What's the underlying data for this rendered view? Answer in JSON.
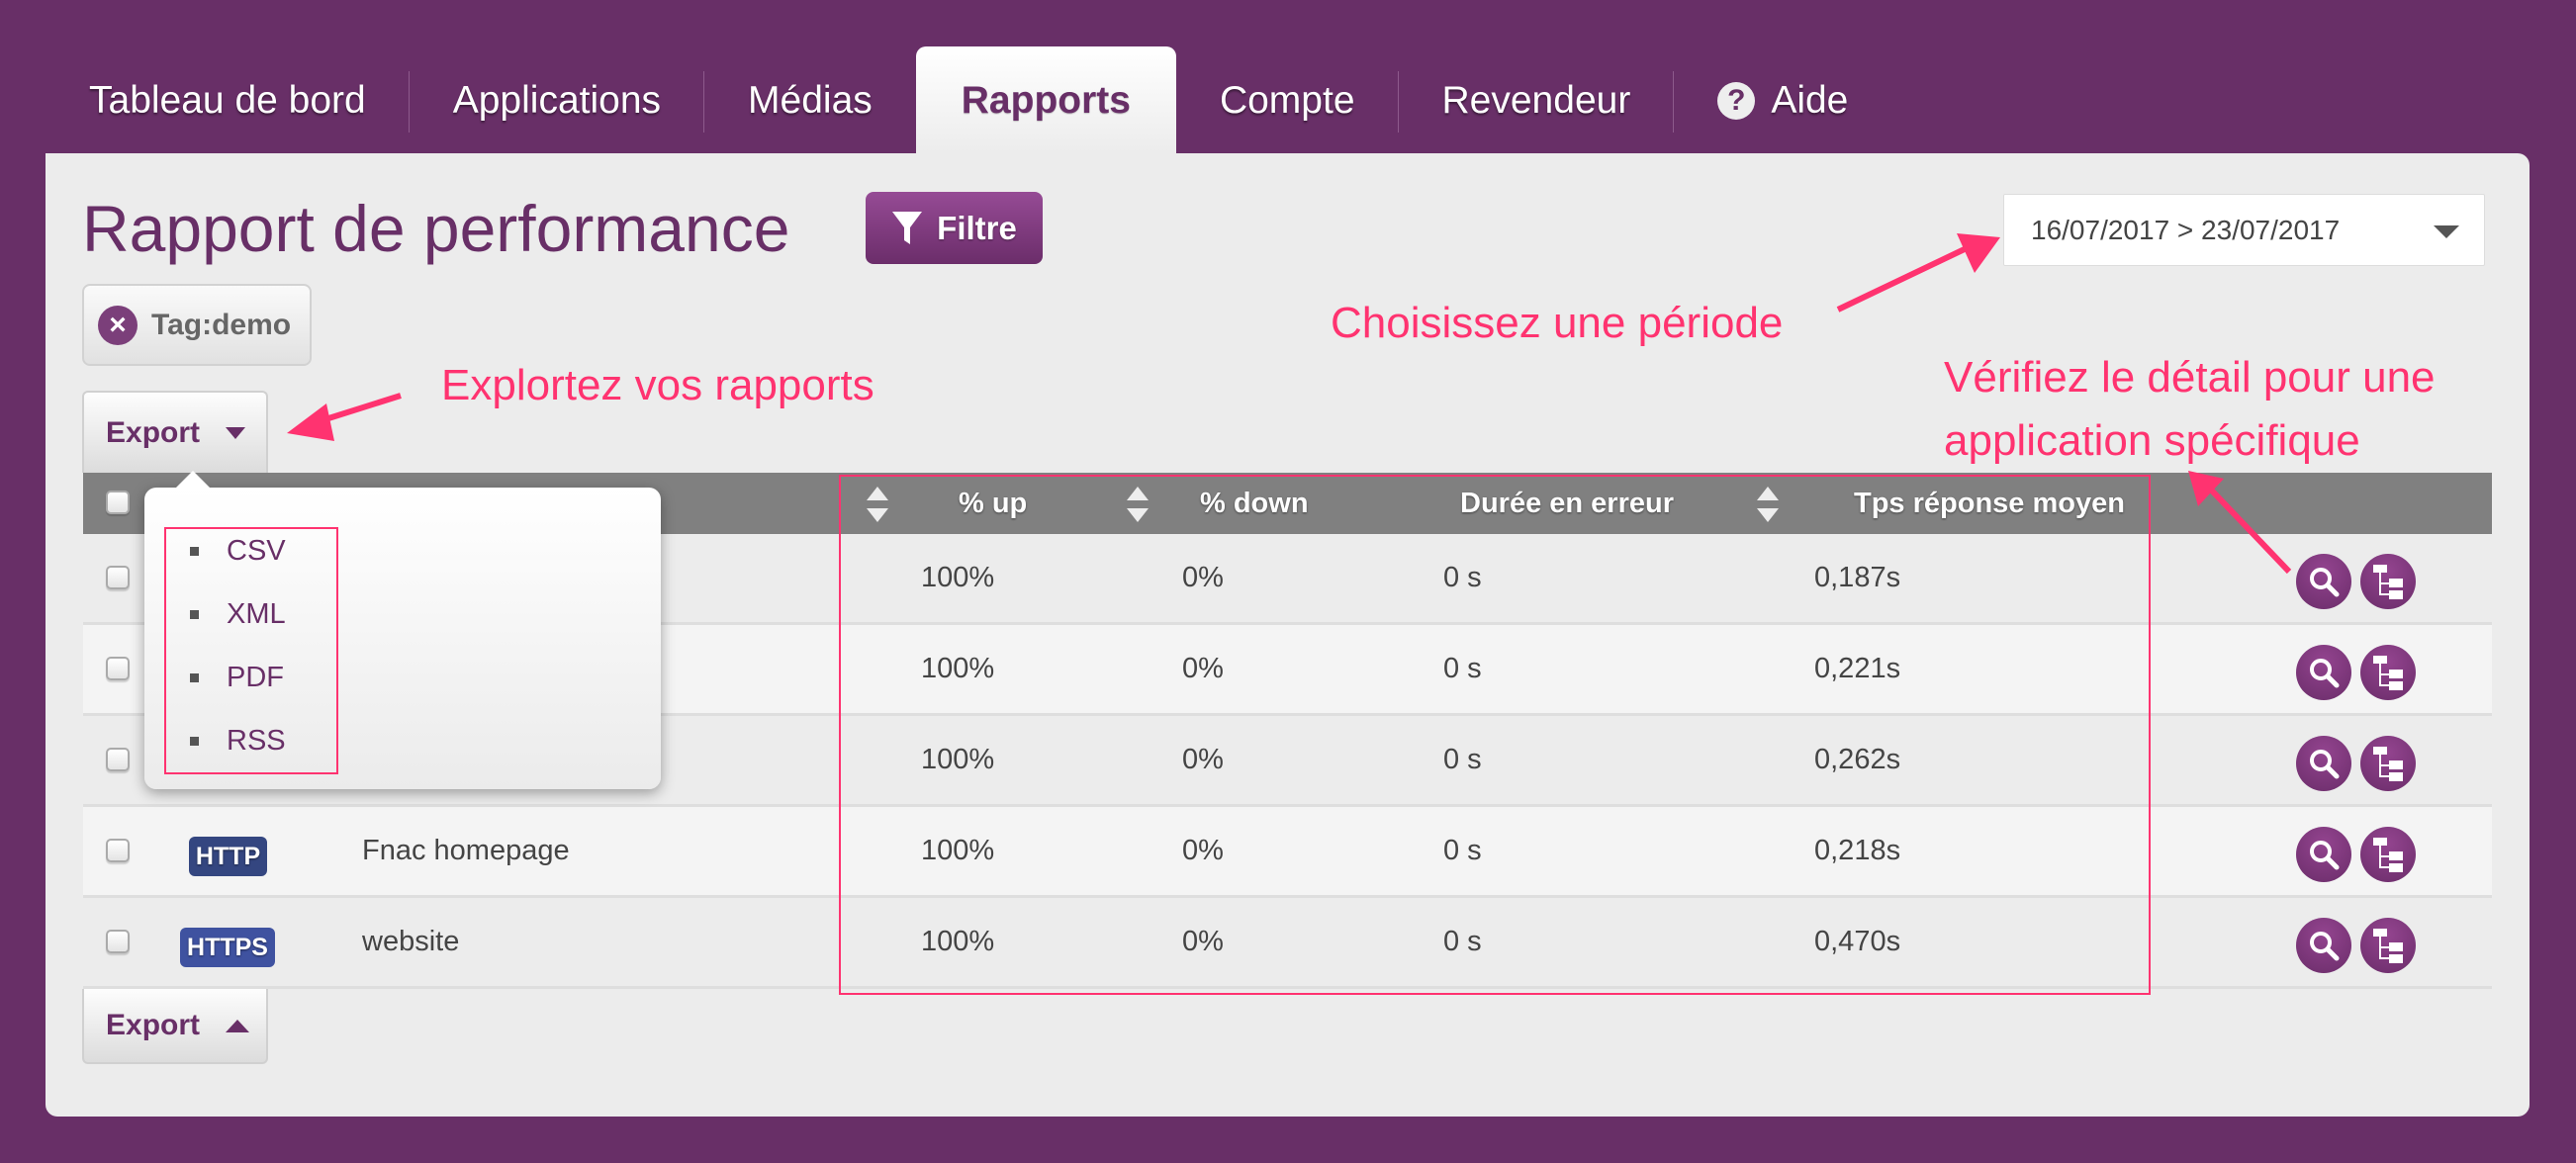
{
  "nav": {
    "tabs": [
      {
        "label": "Tableau de bord",
        "active": false
      },
      {
        "label": "Applications",
        "active": false
      },
      {
        "label": "Médias",
        "active": false
      },
      {
        "label": "Rapports",
        "active": true
      },
      {
        "label": "Compte",
        "active": false
      },
      {
        "label": "Revendeur",
        "active": false
      },
      {
        "label": "Aide",
        "active": false,
        "icon": "help-icon",
        "icon_glyph": "?"
      }
    ]
  },
  "page": {
    "title": "Rapport de performance",
    "filter_label": "Filtre",
    "date_range": "16/07/2017 > 23/07/2017",
    "tag_filter": "Tag:demo",
    "tag_remove_glyph": "×",
    "export_label": "Export"
  },
  "export_menu": {
    "items": [
      "CSV",
      "XML",
      "PDF",
      "RSS"
    ]
  },
  "table": {
    "columns": [
      "% up",
      "% down",
      "Durée en erreur",
      "Tps réponse moyen"
    ],
    "rows": [
      {
        "protocol": "",
        "name": "",
        "up": "100%",
        "down": "0%",
        "error_duration": "0 s",
        "avg_response": "0,187s"
      },
      {
        "protocol": "",
        "name": "",
        "up": "100%",
        "down": "0%",
        "error_duration": "0 s",
        "avg_response": "0,221s"
      },
      {
        "protocol": "",
        "name": "",
        "up": "100%",
        "down": "0%",
        "error_duration": "0 s",
        "avg_response": "0,262s"
      },
      {
        "protocol": "HTTP",
        "name": "Fnac homepage",
        "up": "100%",
        "down": "0%",
        "error_duration": "0 s",
        "avg_response": "0,218s"
      },
      {
        "protocol": "HTTPS",
        "name": "website",
        "up": "100%",
        "down": "0%",
        "error_duration": "0 s",
        "avg_response": "0,470s"
      }
    ]
  },
  "annotations": {
    "explore": "Explortez vos rapports",
    "period": "Choisissez une période",
    "detail_line1": "Vérifiez le détail pour une",
    "detail_line2": "application spécifique"
  },
  "colors": {
    "brand_purple": "#682f67",
    "annotation_pink": "#ff3370",
    "http_badge": "#344680",
    "https_badge": "#3f52a0"
  }
}
